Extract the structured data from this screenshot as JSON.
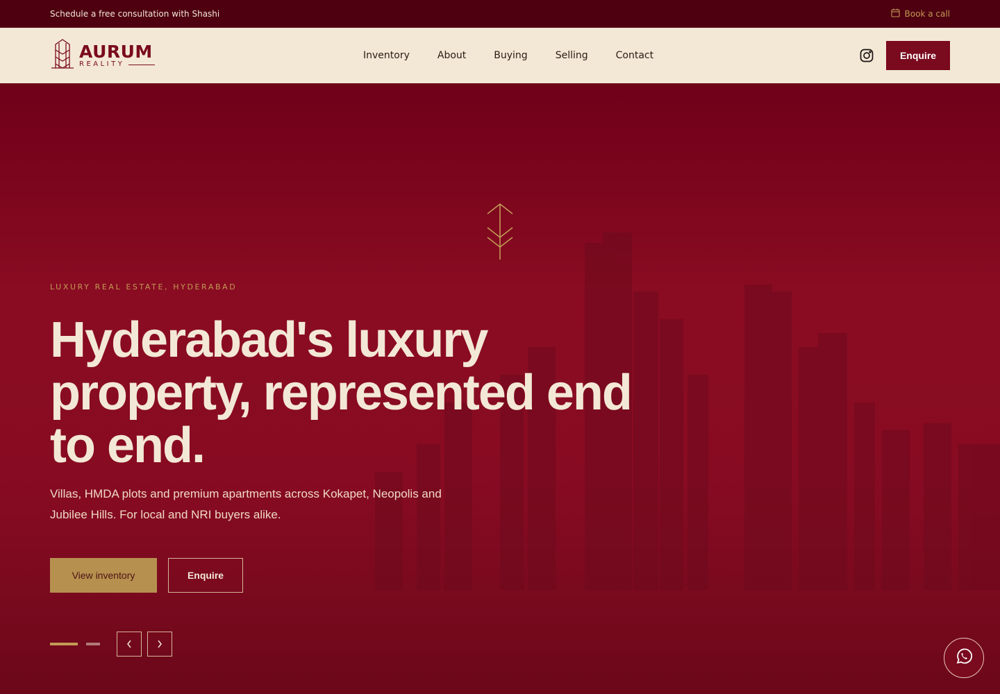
{
  "topbar": {
    "announcement": "Schedule a free consultation with Shashi",
    "book_label": "Book a call",
    "book_icon": "calendar-icon"
  },
  "header": {
    "logo_main": "AURUM",
    "logo_sub": "REALITY",
    "nav": [
      "Inventory",
      "About",
      "Buying",
      "Selling",
      "Contact"
    ],
    "instagram_icon": "instagram-icon",
    "enquire_label": "Enquire"
  },
  "hero": {
    "kicker": "LUXURY REAL ESTATE, HYDERABAD",
    "headline": "Hyderabad's luxury property, represented end to end.",
    "subcopy": "Villas, HMDA plots and premium apartments across Kokapet, Neopolis and Jubilee Hills. For local and NRI buyers alike.",
    "primary_cta": "View inventory",
    "secondary_cta": "Enquire",
    "slide_count": 2,
    "active_slide": 1
  },
  "colors": {
    "brand_maroon": "#7a0a1e",
    "topbar": "#4e0010",
    "cream": "#f3e8d5",
    "gold": "#c39a55"
  }
}
